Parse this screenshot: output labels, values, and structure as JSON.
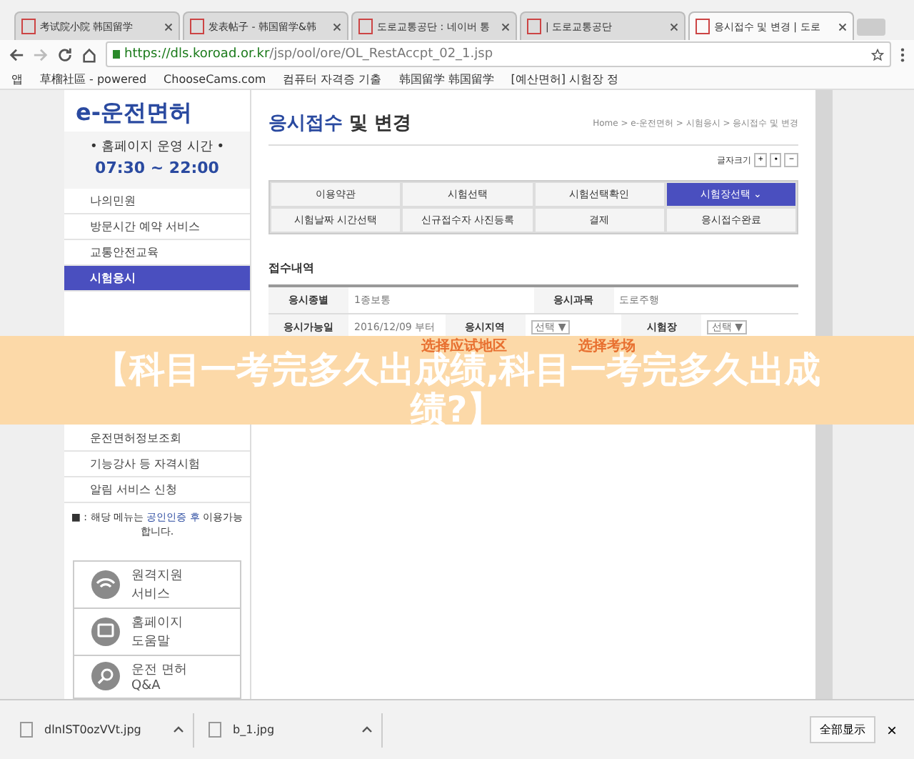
{
  "browser": {
    "tabs": [
      {
        "title": "考试院小院 韩国留学",
        "selected": false
      },
      {
        "title": "发表帖子 - 韩国留学&韩",
        "selected": false
      },
      {
        "title": "도로교통공단 : 네이버 통",
        "selected": false
      },
      {
        "title": "| 도로교통공단",
        "selected": false
      },
      {
        "title": "응시접수 및 변경 | 도로",
        "selected": true
      }
    ],
    "url_host": "https://dls.koroad.or.kr",
    "url_path": "/jsp/ool/ore/OL_RestAccpt_02_1.jsp",
    "bookmarks": [
      "앱",
      "草榴社區 - powered",
      "ChooseCams.com",
      "컴퓨터 자격증 기출",
      "韩国留学 韩国留学",
      "[예산면허] 시험장 정"
    ]
  },
  "sidebar": {
    "logo": "e-운전면허",
    "hours_label": "• 홈페이지 운영 시간 •",
    "hours": "07:30 ~ 22:00",
    "menu": [
      {
        "label": "나의민원",
        "selected": false
      },
      {
        "label": "방문시간 예약 서비스",
        "selected": false
      },
      {
        "label": "교통안전교육",
        "selected": false
      },
      {
        "label": "시험응시",
        "selected": true
      }
    ],
    "menu_after": [
      {
        "label": "운전면허정보조회"
      },
      {
        "label": "기능강사 등 자격시험"
      },
      {
        "label": "알림 서비스 신청"
      }
    ],
    "note_before": "■ : 해당 메뉴는",
    "note_link": "공인인증 후",
    "note_after": "이용가능합니다.",
    "help": [
      {
        "kind": "remote",
        "lines": [
          "원격지원",
          "서비스"
        ]
      },
      {
        "kind": "help",
        "lines": [
          "홈페이지",
          "도움말"
        ]
      },
      {
        "kind": "qa",
        "lines": [
          "운전 면허",
          "Q&A"
        ]
      }
    ]
  },
  "main": {
    "title_blue": "응시접수",
    "title_rest": "및 변경",
    "breadcrumb": "Home > e-운전면허 > 시험응시 > 응시접수 및 변경",
    "font_size_label": "글자크기",
    "font_size_buttons": [
      "+",
      "•",
      "−"
    ],
    "steps": [
      {
        "label": "이용약관",
        "selected": false
      },
      {
        "label": "시험선택",
        "selected": false
      },
      {
        "label": "시험선택확인",
        "selected": false
      },
      {
        "label": "시험장선택 ⌄",
        "selected": true
      },
      {
        "label": "시험날짜 시간선택",
        "selected": false
      },
      {
        "label": "신규접수자 사진등록",
        "selected": false
      },
      {
        "label": "결제",
        "selected": false
      },
      {
        "label": "응시접수완료",
        "selected": false
      }
    ],
    "section": "접수내역",
    "row1": [
      "응시종별",
      "1종보통",
      "응시과목",
      "도로주행"
    ],
    "row2": {
      "date_label": "응시가능일",
      "date": "2016/12/09 부터",
      "region_label": "응시지역",
      "region": "선택 ▼",
      "site_label": "시험장",
      "site": "선택 ▼"
    }
  },
  "overlay": {
    "title": "【科目一考完多久出成绩,科目一考完多久出成绩?】",
    "notes": [
      "选择应试地区",
      "选择考场"
    ]
  },
  "downloads": {
    "files": [
      "dlnIST0ozVVt.jpg",
      "b_1.jpg"
    ],
    "show_all": "全部显示",
    "close": "×"
  }
}
